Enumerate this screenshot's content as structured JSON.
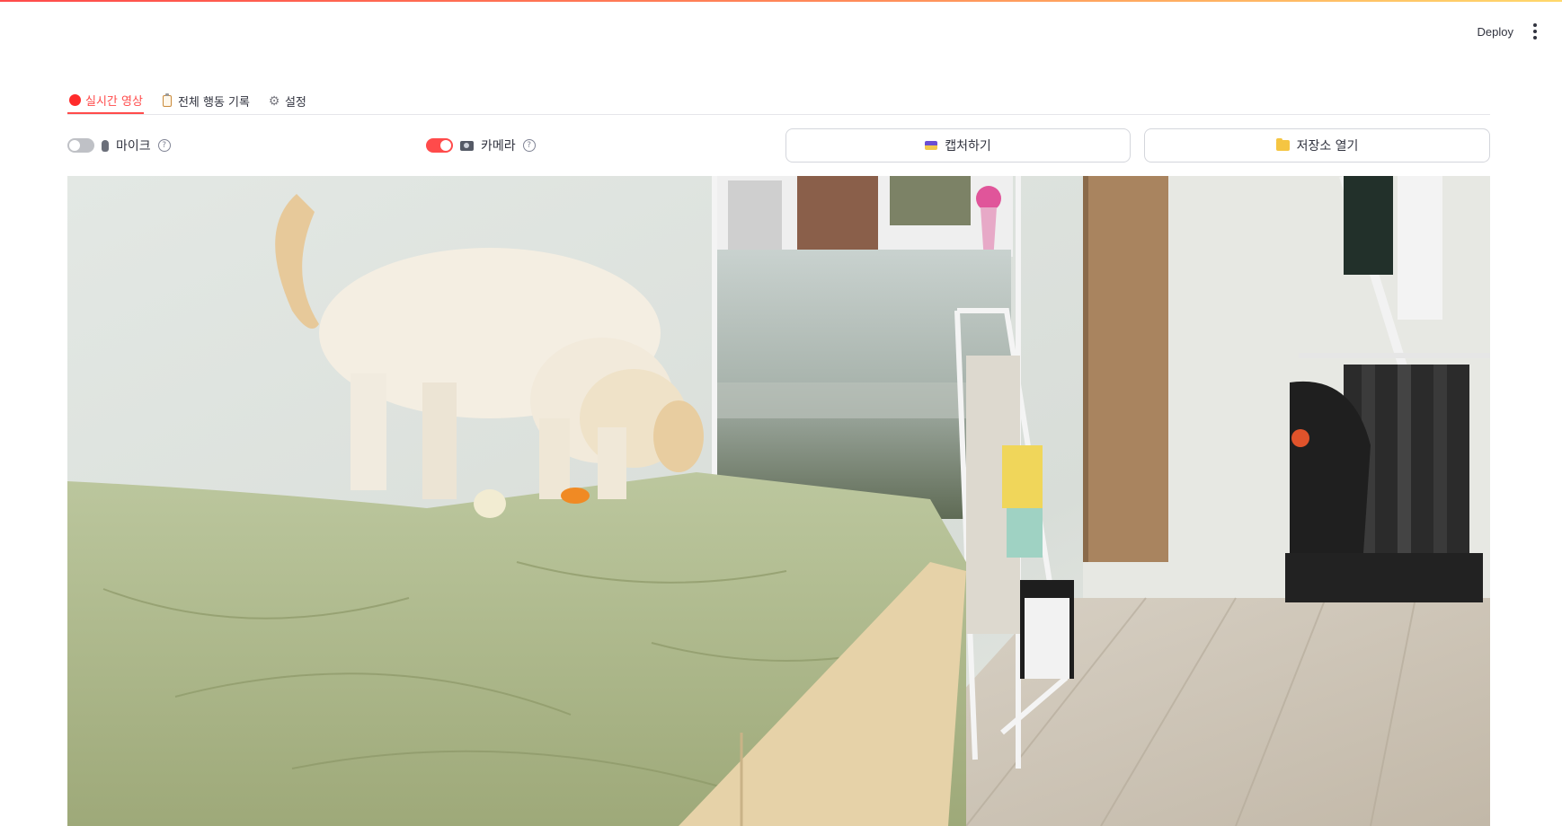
{
  "header": {
    "deploy_label": "Deploy",
    "menu_icon": "kebab-menu-icon"
  },
  "tabs": [
    {
      "label": "실시간 영상",
      "icon": "red-circle-icon",
      "active": true
    },
    {
      "label": "전체 행동 기록",
      "icon": "clipboard-icon",
      "active": false
    },
    {
      "label": "설정",
      "icon": "gear-icon",
      "active": false
    }
  ],
  "controls": {
    "mic": {
      "label": "마이크",
      "icon": "microphone-icon",
      "enabled": false
    },
    "camera": {
      "label": "카메라",
      "icon": "camera-icon",
      "enabled": true
    },
    "capture_button": {
      "label": "캡처하기",
      "icon": "camera-flash-icon"
    },
    "storage_button": {
      "label": "저장소 열기",
      "icon": "folder-icon"
    }
  },
  "colors": {
    "accent": "#ff4b4b",
    "text": "#31333f",
    "border": "#d4d6dc"
  }
}
